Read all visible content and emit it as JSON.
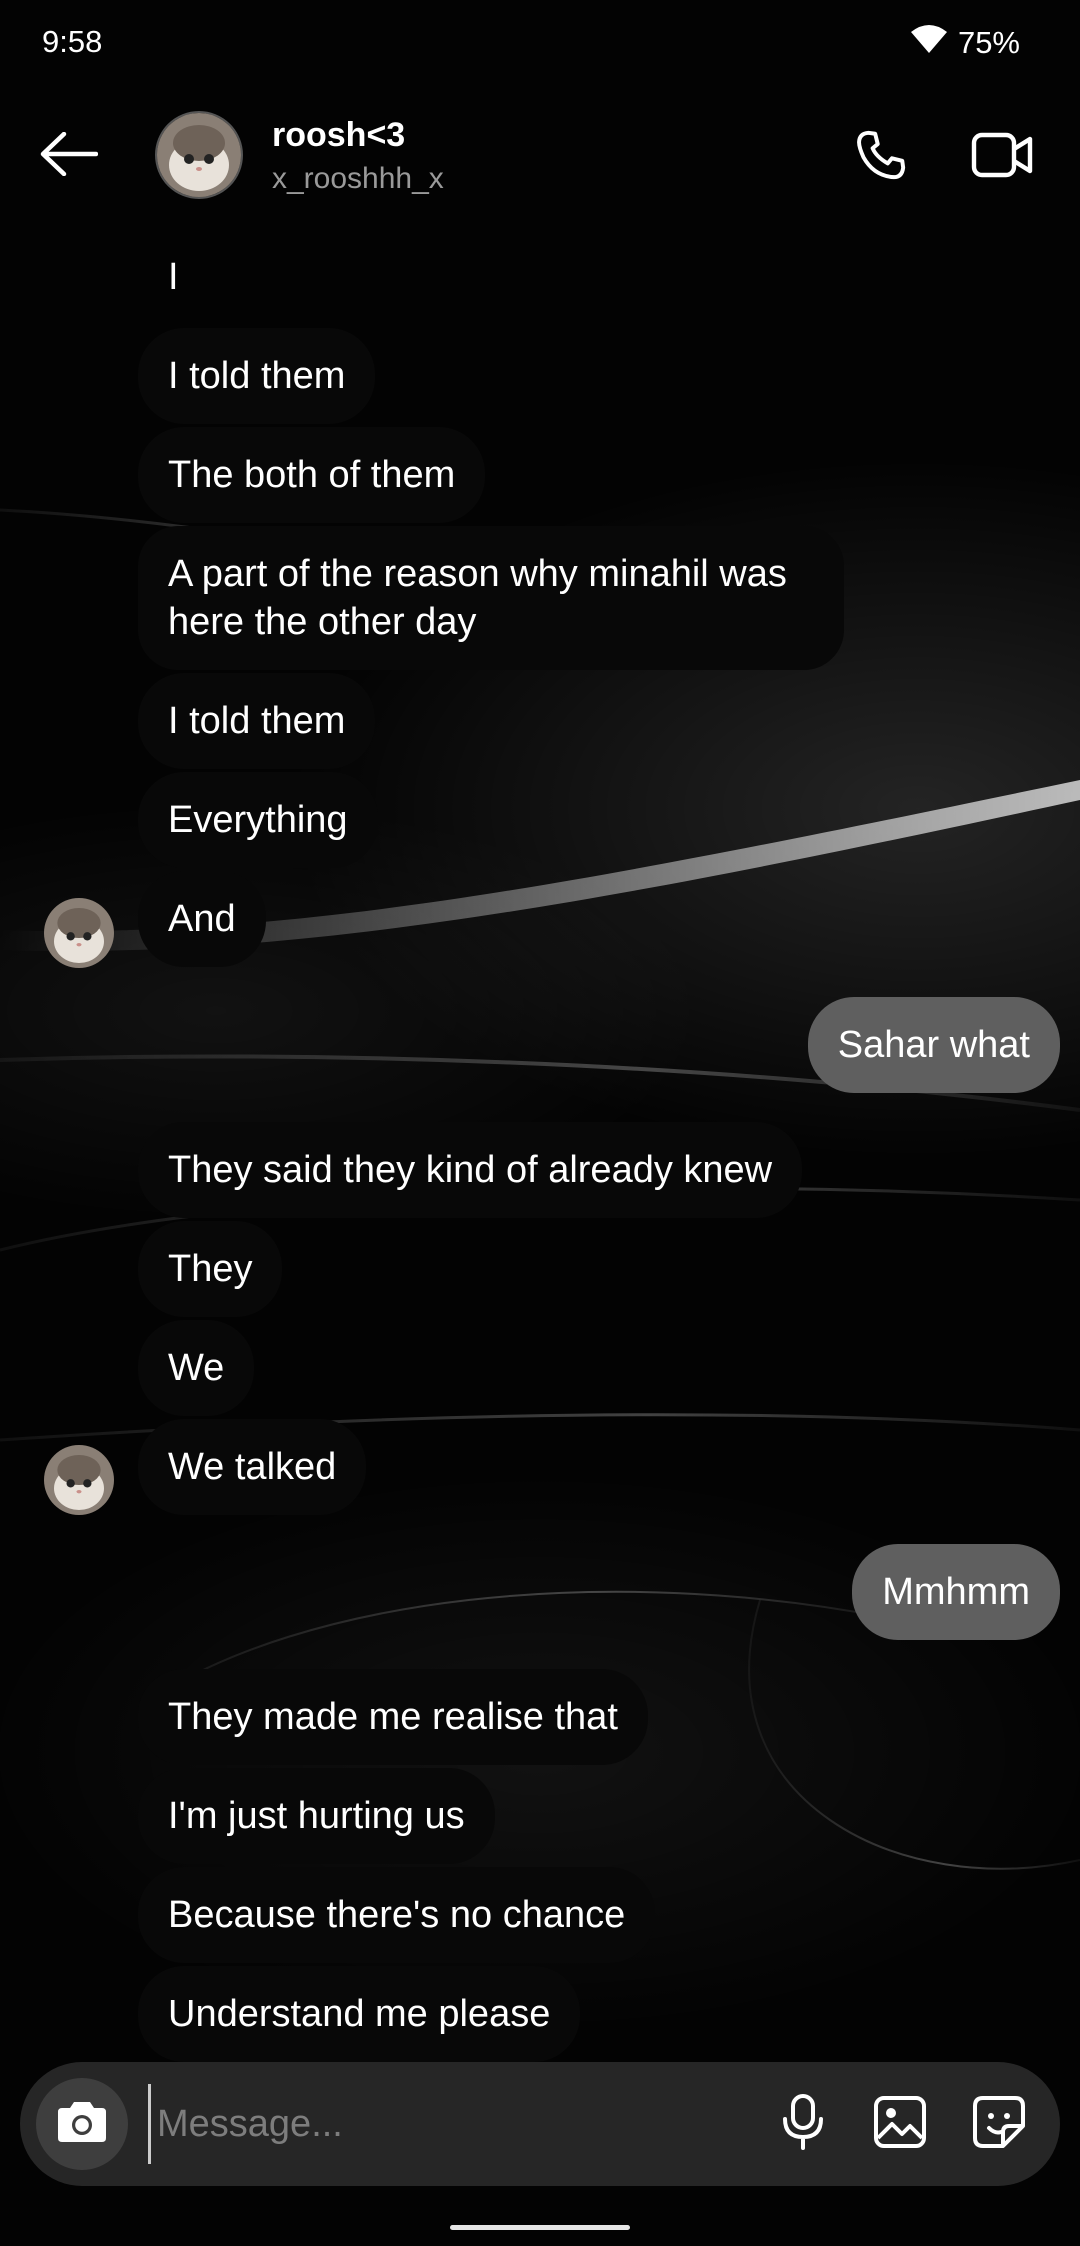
{
  "status_bar": {
    "time": "9:58",
    "battery": "75%"
  },
  "header": {
    "name": "roosh<3",
    "username": "x_rooshhh_x"
  },
  "messages": [
    {
      "text": "I",
      "side": "in"
    },
    {
      "text": "I told them",
      "side": "in"
    },
    {
      "text": "The both of them",
      "side": "in"
    },
    {
      "text": "A part of the reason why minahil was here the other day",
      "side": "in"
    },
    {
      "text": "I told them",
      "side": "in"
    },
    {
      "text": "Everything",
      "side": "in"
    },
    {
      "text": "And",
      "side": "in"
    },
    {
      "text": "Sahar what",
      "side": "out"
    },
    {
      "text": "They said they kind of already knew",
      "side": "in"
    },
    {
      "text": "They",
      "side": "in"
    },
    {
      "text": "We",
      "side": "in"
    },
    {
      "text": "We talked",
      "side": "in"
    },
    {
      "text": "Mmhmm",
      "side": "out"
    },
    {
      "text": "They made me realise that",
      "side": "in"
    },
    {
      "text": "I'm just hurting us",
      "side": "in"
    },
    {
      "text": "Because there's no chance",
      "side": "in"
    },
    {
      "text": "Understand me please",
      "side": "in"
    }
  ],
  "composer": {
    "placeholder": "Message..."
  },
  "icons": {
    "back": "arrow-left-icon",
    "call": "phone-icon",
    "video": "video-camera-icon",
    "camera": "camera-icon",
    "mic": "microphone-icon",
    "gallery": "image-icon",
    "sticker": "sticker-icon",
    "wifi": "wifi-icon"
  },
  "colors": {
    "background": "#030303",
    "incoming_bubble": "#080808",
    "outgoing_bubble": "#5f5f5f",
    "composer": "#262626",
    "secondary_text": "#9a9a9a"
  }
}
